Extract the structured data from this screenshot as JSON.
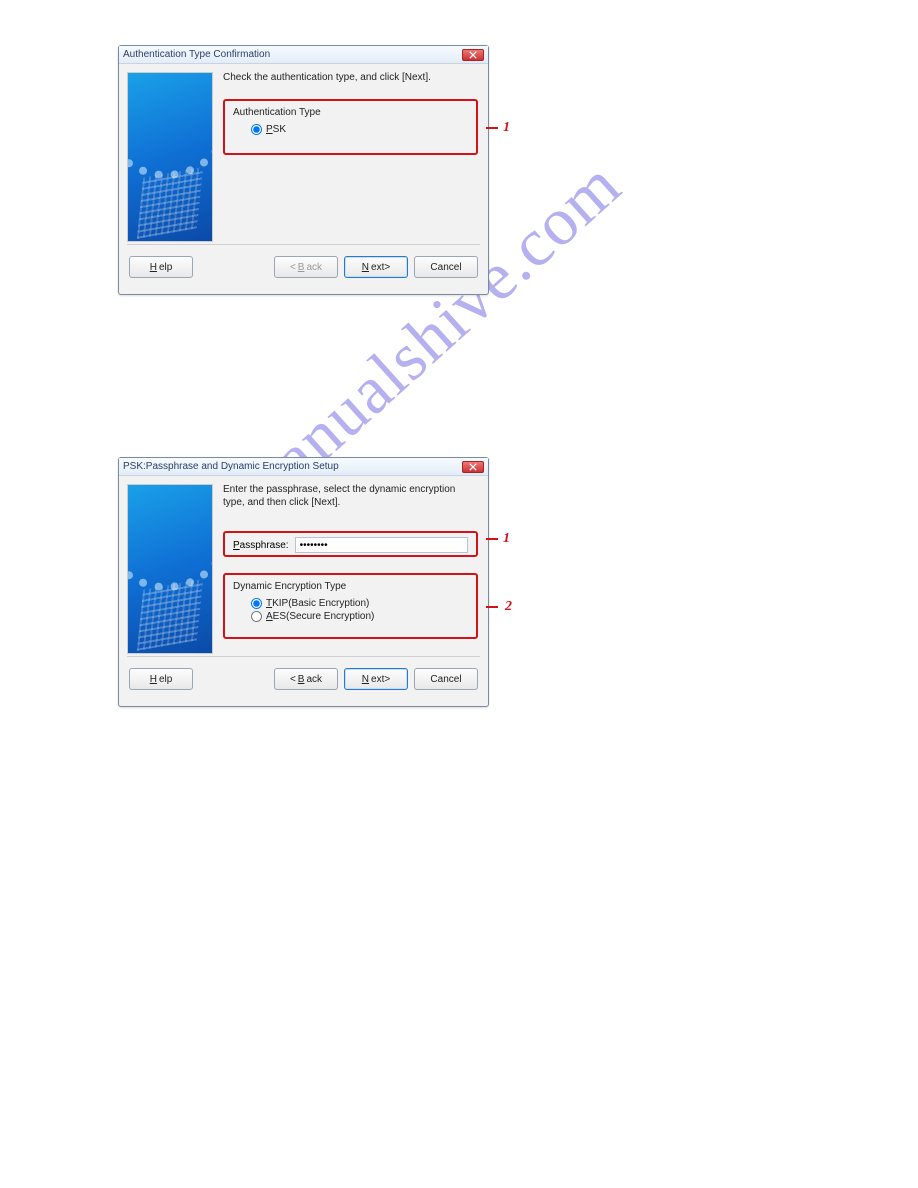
{
  "watermark": "manualshive.com",
  "dialog1": {
    "title": "Authentication Type Confirmation",
    "instruction": "Check the authentication type, and click [Next].",
    "group": {
      "legend": "Authentication Type",
      "option_underline": "P",
      "option_rest": "SK",
      "checked": true,
      "marker": "1"
    },
    "buttons": {
      "help_underline": "H",
      "help_rest": "elp",
      "back_lt": "<",
      "back_underline": "B",
      "back_rest": "ack",
      "next_underline": "N",
      "next_rest": "ext>",
      "cancel": "Cancel"
    }
  },
  "dialog2": {
    "title": "PSK:Passphrase and Dynamic Encryption Setup",
    "instruction": "Enter the passphrase, select the dynamic encryption type, and then click [Next].",
    "pass": {
      "label_underline": "P",
      "label_rest": "assphrase:",
      "value": "••••••••",
      "marker": "1"
    },
    "enc": {
      "legend": "Dynamic Encryption Type",
      "opt1_underline": "T",
      "opt1_rest": "KIP(Basic Encryption)",
      "opt1_checked": true,
      "opt2_underline": "A",
      "opt2_rest": "ES(Secure Encryption)",
      "opt2_checked": false,
      "marker": "2"
    },
    "buttons": {
      "help_underline": "H",
      "help_rest": "elp",
      "back_lt": "<",
      "back_underline": "B",
      "back_rest": "ack",
      "next_underline": "N",
      "next_rest": "ext>",
      "cancel": "Cancel"
    }
  }
}
